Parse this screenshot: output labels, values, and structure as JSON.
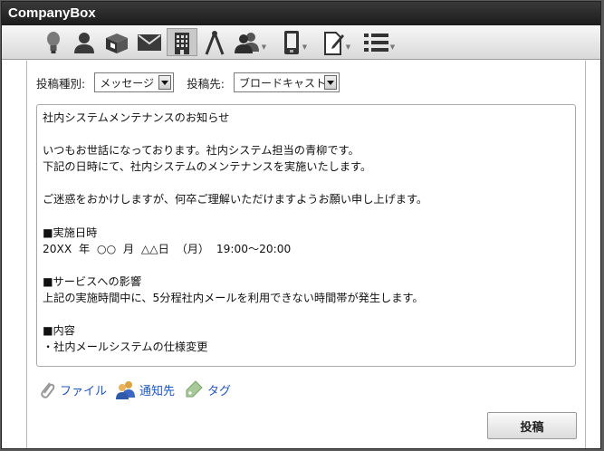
{
  "app": {
    "title": "CompanyBox"
  },
  "toolbar": {
    "icons": [
      "lightbulb-icon",
      "person-icon",
      "box-icon",
      "mail-icon",
      "building-icon",
      "compass-icon",
      "group-icon",
      "device-icon",
      "document-edit-icon",
      "list-icon"
    ],
    "active": "building-icon"
  },
  "form": {
    "type_label": "投稿種別:",
    "type_value": "メッセージ",
    "dest_label": "投稿先:",
    "dest_value": "ブロードキャスト",
    "body": "社内システムメンテナンスのお知らせ\n\nいつもお世話になっております。社内システム担当の青柳です。\n下記の日時にて、社内システムのメンテナンスを実施いたします。\n\nご迷惑をおかけしますが、何卒ご理解いただけますようお願い申し上げます。\n\n■実施日時\n20XX  年  ○○  月  △△日  （月）  19:00～20:00\n\n■サービスへの影響\n上記の実施時間中に、5分程社内メールを利用できない時間帯が発生します。\n\n■内容\n・社内メールシステムの仕様変更"
  },
  "actions": {
    "file_label": "ファイル",
    "notify_label": "通知先",
    "tag_label": "タグ",
    "post_label": "投稿"
  },
  "colors": {
    "titlebar": "#2a2a2a",
    "link": "#2255bb"
  }
}
